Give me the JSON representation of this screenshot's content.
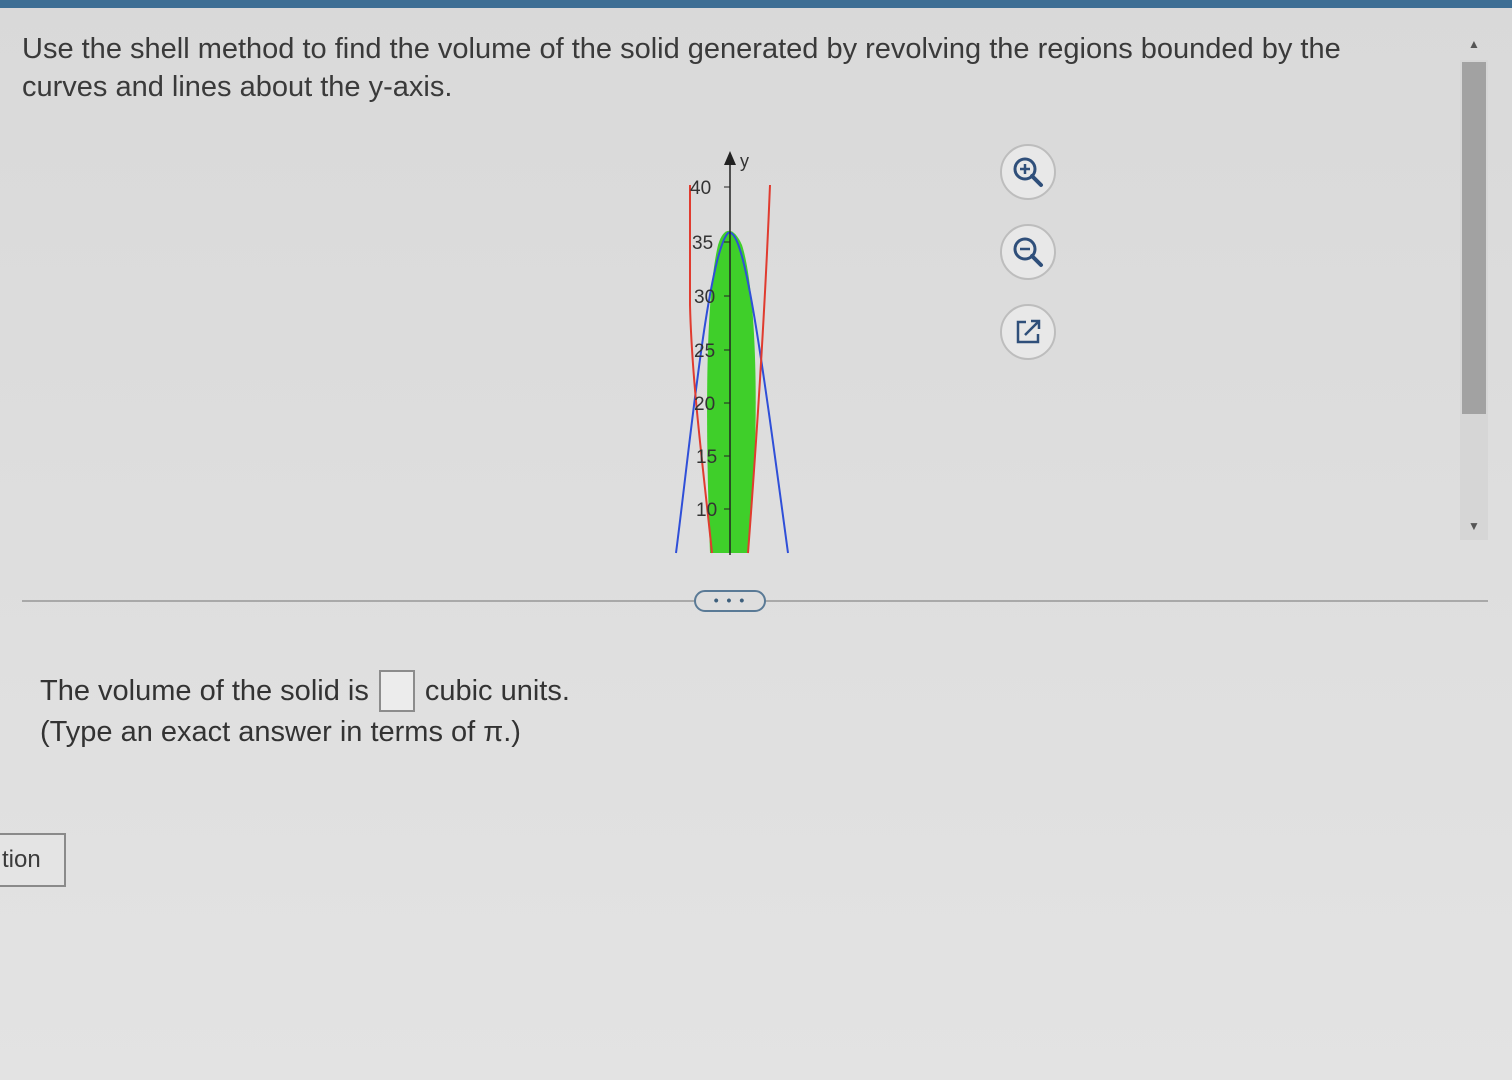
{
  "question": {
    "text": "Use the shell method to find the volume of the solid generated by revolving the regions bounded by the curves and lines about the y-axis."
  },
  "graph": {
    "axis_label": "y",
    "y_ticks": [
      "40",
      "35",
      "30",
      "25",
      "20",
      "15",
      "10"
    ],
    "colors": {
      "region": "#3fcf2a",
      "blue_curve": "#2f4fd8",
      "red_curve": "#e03b2f",
      "axis": "#222222"
    }
  },
  "tools": {
    "zoom_in": "zoom-in-icon",
    "zoom_out": "zoom-out-icon",
    "popout": "external-link-icon"
  },
  "more_button": {
    "label": "• • •"
  },
  "answer": {
    "prefix": "The volume of the solid is",
    "suffix": "cubic units.",
    "value": "",
    "hint": "(Type an exact answer in terms of π.)"
  },
  "side_button": {
    "label": "tion"
  }
}
